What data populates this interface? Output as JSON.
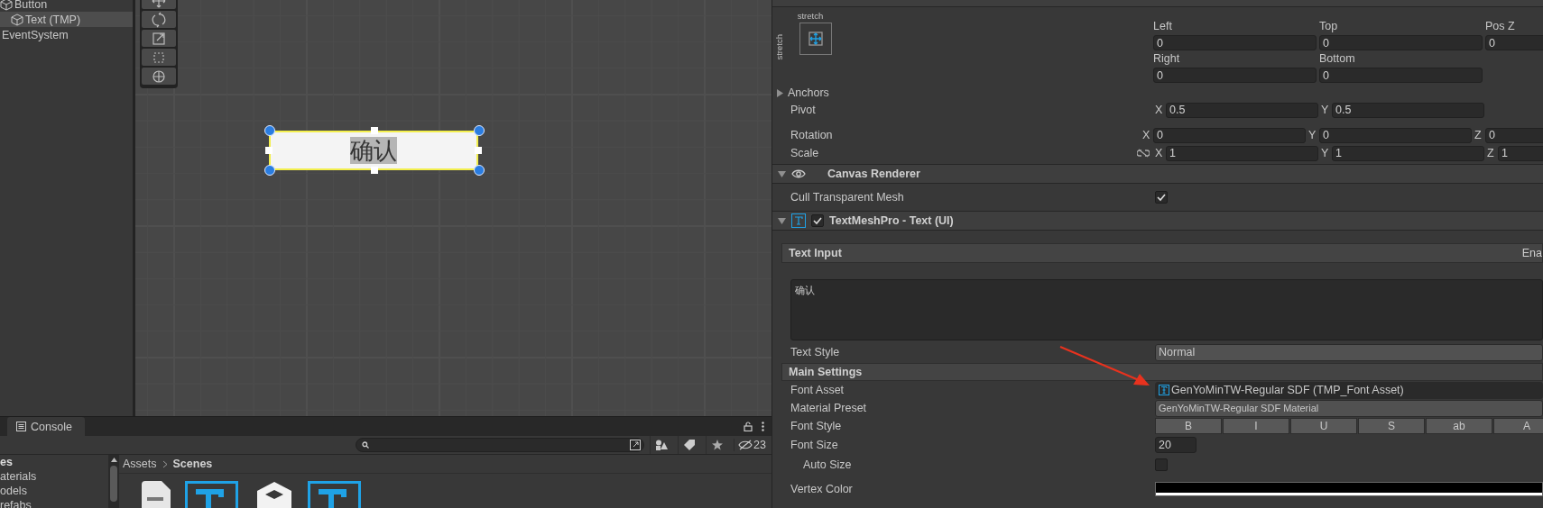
{
  "hierarchy": {
    "items": [
      {
        "label": "Button",
        "kind": "gameobject",
        "selected": false,
        "children": [
          {
            "label": "Text (TMP)",
            "kind": "gameobject",
            "selected": true
          }
        ]
      },
      {
        "label": "EventSystem",
        "kind": "plain",
        "selected": false
      }
    ]
  },
  "scene": {
    "button_text": "确认"
  },
  "inspector": {
    "rect_transform": {
      "anchor_preset": {
        "top": "stretch",
        "side": "stretch"
      },
      "fields": [
        {
          "label": "Left",
          "value": "0"
        },
        {
          "label": "Top",
          "value": "0"
        },
        {
          "label": "Pos Z",
          "value": "0"
        },
        {
          "label": "Right",
          "value": "0"
        },
        {
          "label": "Bottom",
          "value": "0"
        }
      ],
      "anchors": {
        "label": "Anchors",
        "expanded": false
      },
      "rows": [
        {
          "label": "Pivot",
          "axes": [
            {
              "axis": "X",
              "value": "0.5"
            },
            {
              "axis": "Y",
              "value": "0.5"
            }
          ]
        },
        {
          "label": "Rotation",
          "axes": [
            {
              "axis": "X",
              "value": "0"
            },
            {
              "axis": "Y",
              "value": "0"
            },
            {
              "axis": "Z",
              "value": "0"
            }
          ]
        },
        {
          "label": "Scale",
          "axes": [
            {
              "axis": "X",
              "value": "1"
            },
            {
              "axis": "Y",
              "value": "1"
            },
            {
              "axis": "Z",
              "value": "1"
            }
          ]
        }
      ]
    },
    "canvas_renderer": {
      "title": "Canvas Renderer",
      "expanded": true,
      "cull_label": "Cull Transparent Mesh",
      "cull_checked": true
    },
    "textmeshpro": {
      "title": "TextMeshPro - Text (UI)",
      "expanded": true,
      "enabled": true,
      "text_input": {
        "header": "Text Input",
        "enable_label": "Ena",
        "text": "确认"
      },
      "text_style": {
        "label": "Text Style",
        "value": "Normal"
      },
      "main_settings": {
        "header": "Main Settings",
        "rows": [
          {
            "kind": "object",
            "label": "Font Asset",
            "value": "GenYoMinTW-Regular SDF (TMP_Font Asset)"
          },
          {
            "kind": "dropdown",
            "label": "Material Preset",
            "value": "GenYoMinTW-Regular SDF Material"
          },
          {
            "kind": "buttons",
            "label": "Font Style",
            "buttons": [
              {
                "label": "B",
                "selected": false
              },
              {
                "label": "I",
                "selected": false
              },
              {
                "label": "U",
                "selected": false
              },
              {
                "label": "S",
                "selected": false
              },
              {
                "label": "ab",
                "selected": false
              },
              {
                "label": "A",
                "selected": false
              }
            ]
          },
          {
            "kind": "number",
            "label": "Font Size",
            "value": "20"
          },
          {
            "kind": "checkbox",
            "label": "Auto Size",
            "checked": false
          },
          {
            "kind": "color",
            "label": "Vertex Color",
            "color": "#000000"
          }
        ]
      }
    }
  },
  "project": {
    "tab": "Console",
    "hidden_count": "23",
    "folders": [
      {
        "label": "es",
        "selected": true
      },
      {
        "label": "aterials",
        "selected": false
      },
      {
        "label": "odels",
        "selected": false
      },
      {
        "label": "refabs",
        "selected": false
      }
    ],
    "breadcrumb": [
      "Assets",
      "Scenes"
    ]
  }
}
